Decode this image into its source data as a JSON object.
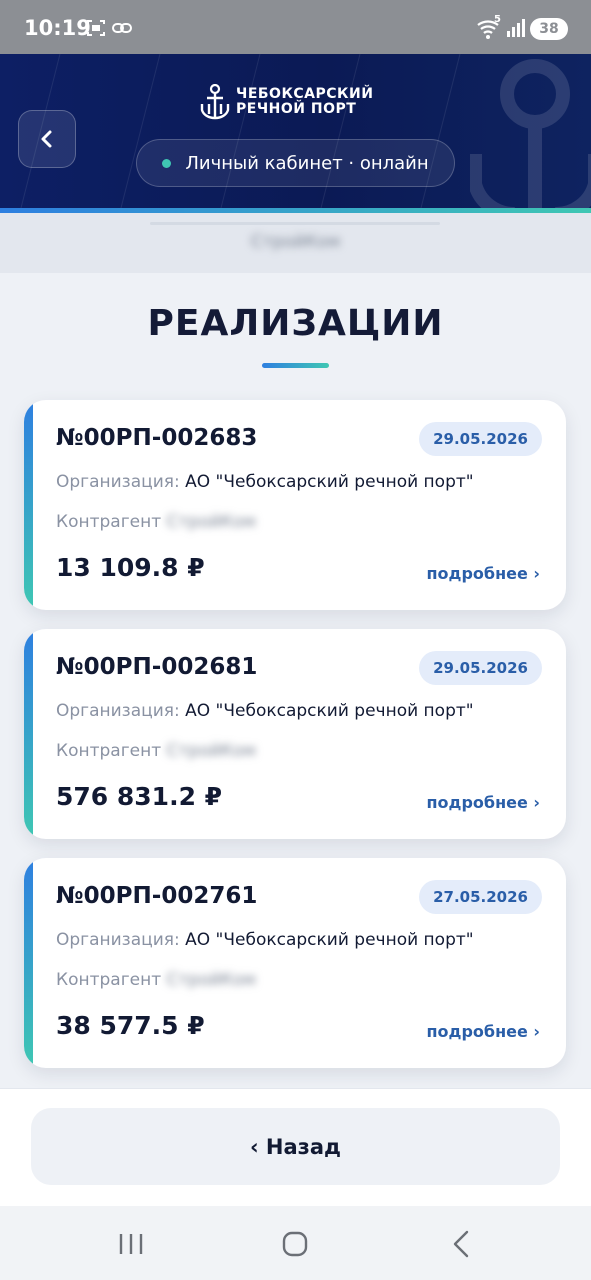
{
  "status_bar": {
    "time": "10:19",
    "battery": "38",
    "network_label": "5"
  },
  "header": {
    "logo_line1": "ЧЕБОКСАРСКИЙ",
    "logo_line2": "РЕЧНОЙ ПОРТ",
    "status_text": "Личный кабинет ·  онлайн",
    "subheader_text": "СтройКом"
  },
  "page": {
    "title": "РЕАЛИЗАЦИИ"
  },
  "cards": [
    {
      "number": "№00РП-002683",
      "date": "29.05.2026",
      "org_label": "Организация:",
      "org_value": "АО \"Чебоксарский речной порт\"",
      "contr_label": "Контрагент",
      "contr_value": "СтройКом",
      "amount": "13 109.8 ₽",
      "details": "подробнее ›"
    },
    {
      "number": "№00РП-002681",
      "date": "29.05.2026",
      "org_label": "Организация:",
      "org_value": "АО \"Чебоксарский речной порт\"",
      "contr_label": "Контрагент",
      "contr_value": "СтройКом",
      "amount": "576 831.2 ₽",
      "details": "подробнее ›"
    },
    {
      "number": "№00РП-002761",
      "date": "27.05.2026",
      "org_label": "Организация:",
      "org_value": "АО \"Чебоксарский речной порт\"",
      "contr_label": "Контрагент",
      "contr_value": "СтройКом",
      "amount": "38 577.5 ₽",
      "details": "подробнее ›"
    }
  ],
  "footer": {
    "back_label": "‹ Назад"
  },
  "colors": {
    "header_bg": "#0d1f64",
    "accent_blue": "#2e7fe0",
    "accent_teal": "#3fc7b3",
    "link": "#2a5ea8"
  }
}
